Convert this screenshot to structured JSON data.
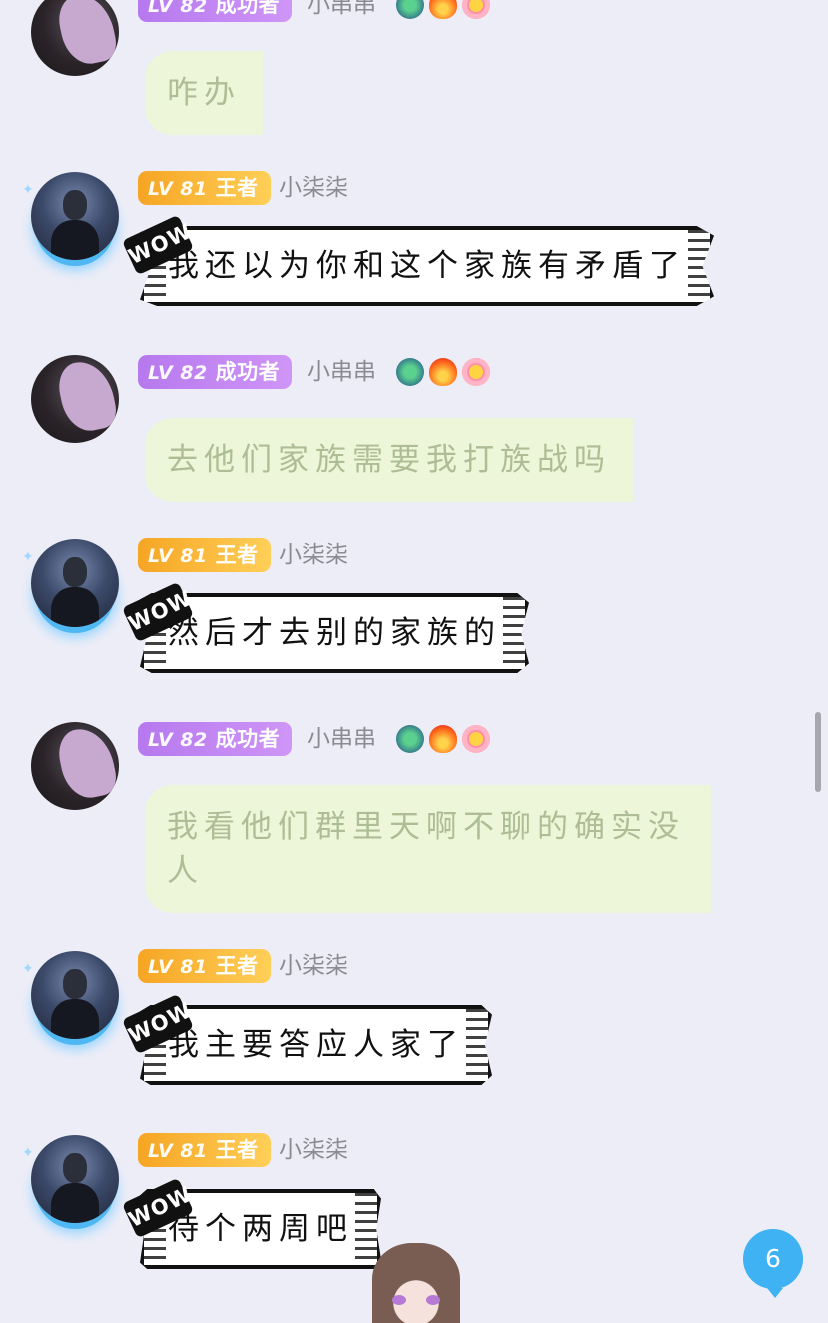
{
  "users": {
    "a": {
      "badge_lv": "LV 82",
      "badge_title": "成功者",
      "name": "小串串",
      "emojis": [
        "dragon-icon",
        "fire-icon",
        "smile-icon"
      ]
    },
    "b": {
      "badge_lv": "LV 81",
      "badge_title": "王者",
      "name": "小柒柒"
    }
  },
  "messages": [
    {
      "text": "咋办"
    },
    {
      "text": "我还以为你和这个家族有矛盾了"
    },
    {
      "text": "去他们家族需要我打族战吗"
    },
    {
      "text": "然后才去别的家族的"
    },
    {
      "text": "我看他们群里天啊不聊的确实没人"
    },
    {
      "text": "我主要答应人家了"
    },
    {
      "text": "待个两周吧"
    }
  ],
  "comic_tag": "WOW",
  "unread_count": "6",
  "colors": {
    "bg": "#ededf7",
    "green_bubble": "#eef6d9",
    "purple_badge": "#b679ee",
    "gold_badge": "#f6a524",
    "unread": "#3eb2f3"
  }
}
